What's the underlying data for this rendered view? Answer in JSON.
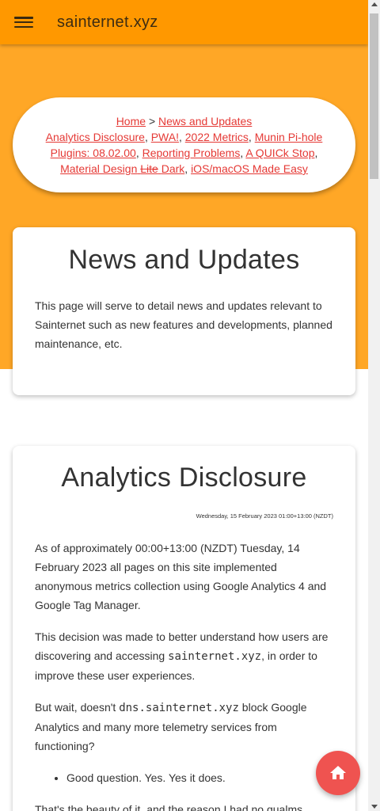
{
  "app_bar": {
    "title": "sainternet.xyz",
    "menu_icon": "menu-icon"
  },
  "breadcrumb": {
    "home": "Home",
    "separator": ">",
    "current": "News and Updates",
    "links": [
      "Analytics Disclosure",
      "PWA!",
      "2022 Metrics",
      "Munin Pi-hole Plugins: 08.02.00",
      "Reporting Problems",
      "A QUICk Stop"
    ],
    "material_prefix": "Material Design",
    "material_struck": "Lite",
    "material_suffix": "Dark",
    "last_link": "iOS/macOS Made Easy",
    "comma": ","
  },
  "news_card": {
    "title": "News and Updates",
    "body": "This page will serve to detail news and updates relevant to Sainternet such as new features and developments, planned maintenance, etc."
  },
  "analytics_card": {
    "title": "Analytics Disclosure",
    "date": "Wednesday, 15 February 2023 01:00+13:00 (NZDT)",
    "p1": "As of approximately 00:00+13:00 (NZDT) Tuesday, 14 February 2023 all pages on this site implemented anonymous metrics collection using Google Analytics 4 and Google Tag Manager.",
    "p2_a": "This decision was made to better understand how users are discovering and accessing ",
    "p2_code": "sainternet.xyz",
    "p2_b": ", in order to improve these user experiences.",
    "p3_a": "But wait, doesn't ",
    "p3_code": "dns.sainternet.xyz",
    "p3_b": " block Google Analytics and many more telemetry services from functioning?",
    "bullet": "Good question. Yes. Yes it does.",
    "p4": "That's the beauty of it, and the reason I had no qualms about"
  },
  "fab": {
    "icon": "home-icon"
  },
  "colors": {
    "app_bar": "#ff9800",
    "hero": "#ffa726",
    "link": "#e53935",
    "fab": "#ef5350"
  }
}
